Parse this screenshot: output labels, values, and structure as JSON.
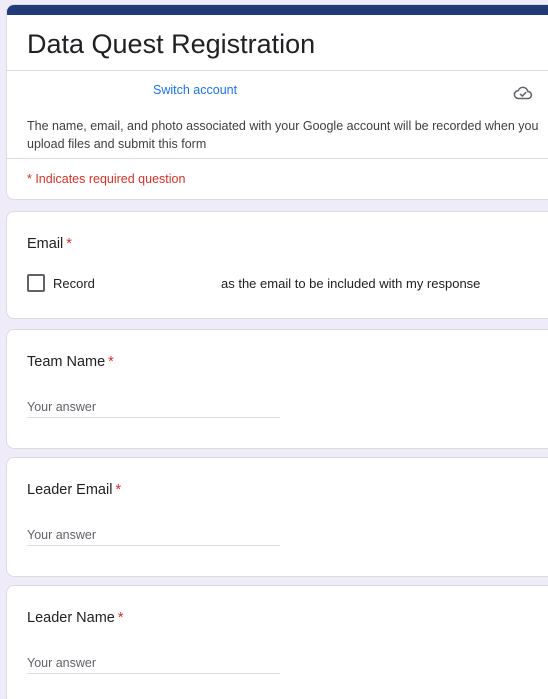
{
  "form": {
    "title": "Data Quest Registration",
    "switch_account": "Switch account",
    "cloud_icon": "cloud-done-icon",
    "disclaimer": "The name, email, and photo associated with your Google account will be recorded when you upload files and submit this form",
    "required_note": "* Indicates required question",
    "accent_color": "#213a7a",
    "required_color": "#d93025",
    "link_color": "#1a73e8",
    "background_color": "#f0ebf8"
  },
  "email_question": {
    "label": "Email",
    "required_mark": "*",
    "checkbox_checked": false,
    "record_word": "Record",
    "record_rest": "as the email to be included with my response"
  },
  "questions": [
    {
      "label": "Team Name",
      "required_mark": "*",
      "placeholder": "Your answer",
      "value": ""
    },
    {
      "label": "Leader Email",
      "required_mark": "*",
      "placeholder": "Your answer",
      "value": ""
    },
    {
      "label": "Leader Name",
      "required_mark": "*",
      "placeholder": "Your answer",
      "value": ""
    }
  ]
}
